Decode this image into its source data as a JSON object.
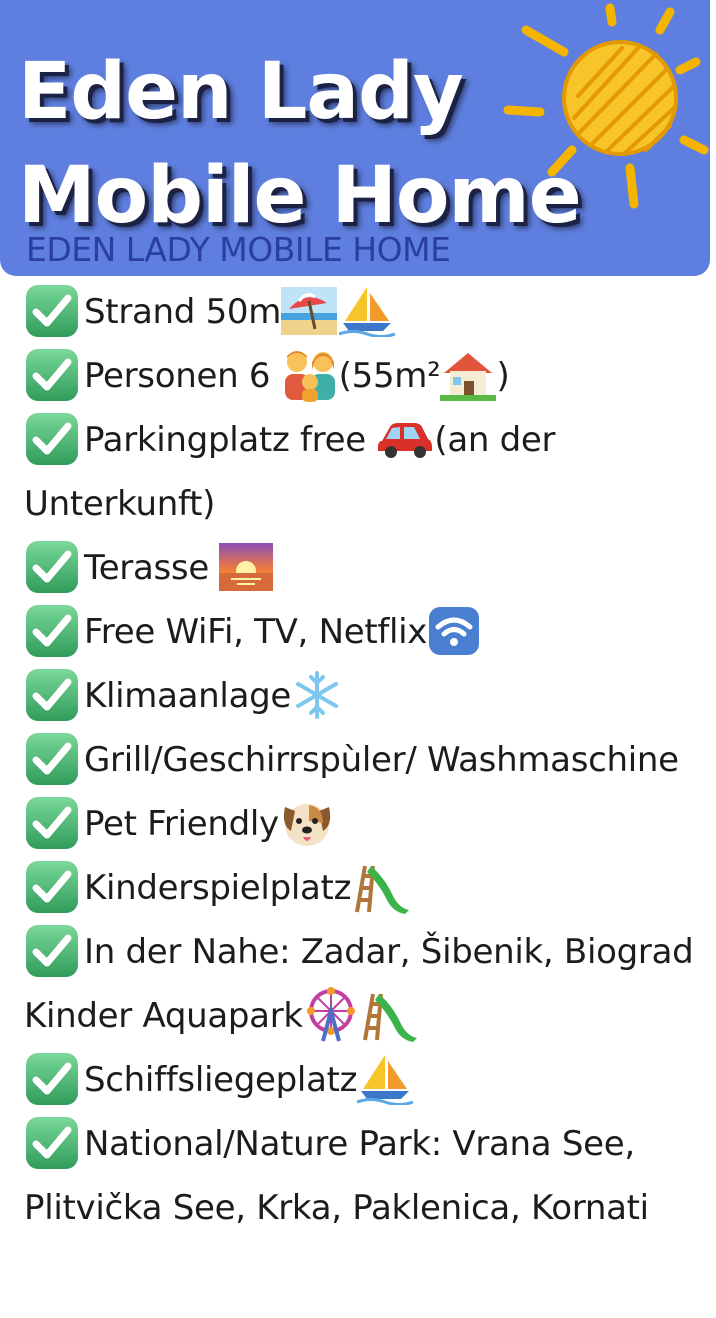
{
  "banner": {
    "title_line1": "Eden Lady",
    "title_line2": "Mobile Home",
    "subtitle": "EDEN LADY MOBILE HOME",
    "icon": "sun-icon",
    "colors": {
      "background": "#5f7fe0",
      "title": "#ffffff",
      "subtitle": "#2a3fa0",
      "sun": "#f5b400"
    }
  },
  "features": [
    {
      "text": "Strand 50m",
      "icons": [
        "beach-umbrella-icon",
        "sailboat-icon"
      ]
    },
    {
      "text_before": "Personen 6 ",
      "text_after": "(55m²",
      "text_end": ")",
      "icons": [
        "family-icon",
        "house-icon"
      ]
    },
    {
      "text": "Parkingplatz free ",
      "text_after": "(an der Unterkunft)",
      "icons": [
        "car-icon"
      ]
    },
    {
      "text": "Terasse ",
      "icons": [
        "sunset-icon"
      ]
    },
    {
      "text": "Free WiFi, TV, Netflix",
      "icons": [
        "wifi-icon"
      ]
    },
    {
      "text": "Klimaanlage",
      "icons": [
        "snowflake-icon"
      ]
    },
    {
      "text": "Grill/Geschirrspùler/ Washmaschine",
      "icons": []
    },
    {
      "text": "Pet Friendly",
      "icons": [
        "dog-face-icon"
      ]
    },
    {
      "text": "Kinderspielplatz",
      "icons": [
        "playground-slide-icon"
      ]
    },
    {
      "text": "In der Nahe: Zadar, Šibenik, Biograd Kinder Aquapark",
      "icons": [
        "ferris-wheel-icon",
        "playground-slide-icon"
      ]
    },
    {
      "text": "Schiffsliegeplatz",
      "icons": [
        "sailboat-icon"
      ]
    },
    {
      "text": "National/Nature Park: Vrana See, Plitvička See, Krka, Paklenica, Kornati",
      "icons": []
    }
  ],
  "check_icon": "check-mark-button-icon",
  "check_color": "#3cae6b"
}
